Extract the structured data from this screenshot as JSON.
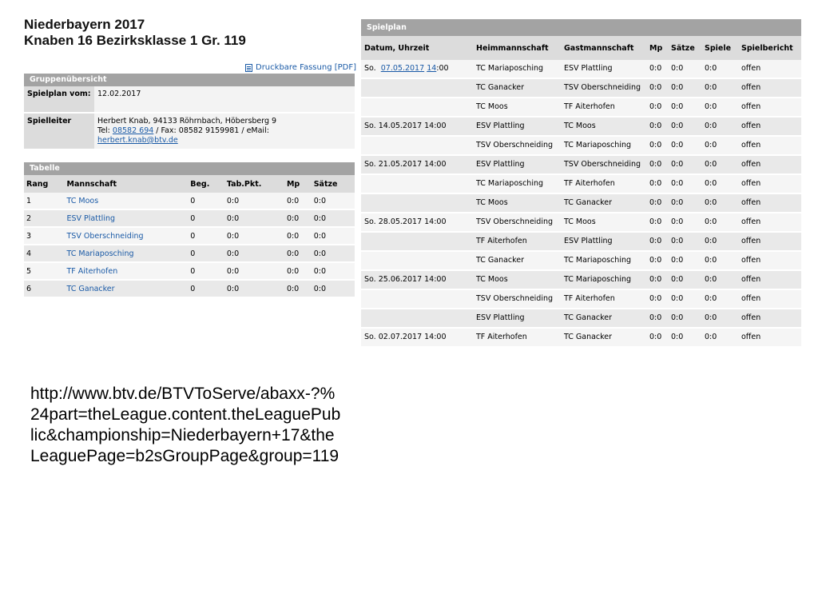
{
  "header": {
    "title_line1": "Niederbayern 2017",
    "title_line2": "Knaben 16 Bezirksklasse 1 Gr. 119",
    "print_link": "Druckbare Fassung [PDF]"
  },
  "gruppe": {
    "heading": "Gruppenübersicht",
    "rows": [
      {
        "key": "Spielplan vom:",
        "value": "12.02.2017"
      },
      {
        "key": "Spielleiter",
        "name": "Herbert Knab, 94133 Röhrnbach, Höbersberg 9",
        "tel_label": "Tel: ",
        "tel": "08582 694",
        "fax": " / Fax: 08582 9159981 / eMail:",
        "email": "herbert.knab@btv.de"
      }
    ]
  },
  "tabelle": {
    "heading": "Tabelle",
    "columns": [
      "Rang",
      "Mannschaft",
      "Beg.",
      "Tab.Pkt.",
      "Mp",
      "Sätze"
    ],
    "rows": [
      [
        "1",
        "TC Moos",
        "0",
        "0:0",
        "0:0",
        "0:0"
      ],
      [
        "2",
        "ESV Plattling",
        "0",
        "0:0",
        "0:0",
        "0:0"
      ],
      [
        "3",
        "TSV Oberschneiding",
        "0",
        "0:0",
        "0:0",
        "0:0"
      ],
      [
        "4",
        "TC Mariaposching",
        "0",
        "0:0",
        "0:0",
        "0:0"
      ],
      [
        "5",
        "TF Aiterhofen",
        "0",
        "0:0",
        "0:0",
        "0:0"
      ],
      [
        "6",
        "TC Ganacker",
        "0",
        "0:0",
        "0:0",
        "0:0"
      ]
    ]
  },
  "spielplan": {
    "heading": "Spielplan",
    "columns": [
      "Datum, Uhrzeit",
      "Heimmannschaft",
      "Gastmannschaft",
      "Mp",
      "Sätze",
      "Spiele",
      "Spielbericht"
    ],
    "rows": [
      {
        "datum": "So.  07.05.2017 14:00",
        "heim": "TC Mariaposching",
        "gast": "ESV Plattling",
        "mp": "0:0",
        "saetze": "0:0",
        "spiele": "0:0",
        "bericht": "offen"
      },
      {
        "datum": "",
        "heim": "TC Ganacker",
        "gast": "TSV Oberschneiding",
        "mp": "0:0",
        "saetze": "0:0",
        "spiele": "0:0",
        "bericht": "offen"
      },
      {
        "datum": "",
        "heim": "TC Moos",
        "gast": "TF Aiterhofen",
        "mp": "0:0",
        "saetze": "0:0",
        "spiele": "0:0",
        "bericht": "offen"
      },
      {
        "datum": "So.  14.05.2017 14:00",
        "heim": "ESV Plattling",
        "gast": "TC Moos",
        "mp": "0:0",
        "saetze": "0:0",
        "spiele": "0:0",
        "bericht": "offen"
      },
      {
        "datum": "",
        "heim": "TSV Oberschneiding",
        "gast": "TC Mariaposching",
        "mp": "0:0",
        "saetze": "0:0",
        "spiele": "0:0",
        "bericht": "offen"
      },
      {
        "datum": "So.  21.05.2017 14:00",
        "heim": "ESV Plattling",
        "gast": "TSV Oberschneiding",
        "mp": "0:0",
        "saetze": "0:0",
        "spiele": "0:0",
        "bericht": "offen"
      },
      {
        "datum": "",
        "heim": "TC Mariaposching",
        "gast": "TF Aiterhofen",
        "mp": "0:0",
        "saetze": "0:0",
        "spiele": "0:0",
        "bericht": "offen"
      },
      {
        "datum": "",
        "heim": "TC Moos",
        "gast": "TC Ganacker",
        "mp": "0:0",
        "saetze": "0:0",
        "spiele": "0:0",
        "bericht": "offen"
      },
      {
        "datum": "So.  28.05.2017 14:00",
        "heim": "TSV Oberschneiding",
        "gast": "TC Moos",
        "mp": "0:0",
        "saetze": "0:0",
        "spiele": "0:0",
        "bericht": "offen"
      },
      {
        "datum": "",
        "heim": "TF Aiterhofen",
        "gast": "ESV Plattling",
        "mp": "0:0",
        "saetze": "0:0",
        "spiele": "0:0",
        "bericht": "offen"
      },
      {
        "datum": "",
        "heim": "TC Ganacker",
        "gast": "TC Mariaposching",
        "mp": "0:0",
        "saetze": "0:0",
        "spiele": "0:0",
        "bericht": "offen"
      },
      {
        "datum": "So.  25.06.2017 14:00",
        "heim": "TC Moos",
        "gast": "TC Mariaposching",
        "mp": "0:0",
        "saetze": "0:0",
        "spiele": "0:0",
        "bericht": "offen"
      },
      {
        "datum": "",
        "heim": "TSV Oberschneiding",
        "gast": "TF Aiterhofen",
        "mp": "0:0",
        "saetze": "0:0",
        "spiele": "0:0",
        "bericht": "offen"
      },
      {
        "datum": "",
        "heim": "ESV Plattling",
        "gast": "TC Ganacker",
        "mp": "0:0",
        "saetze": "0:0",
        "spiele": "0:0",
        "bericht": "offen"
      },
      {
        "datum": "So.  02.07.2017 14:00",
        "heim": "TF Aiterhofen",
        "gast": "TC Ganacker",
        "mp": "0:0",
        "saetze": "0:0",
        "spiele": "0:0",
        "bericht": "offen"
      }
    ]
  },
  "caption": {
    "url": "http://www.btv.de/BTVToServe/abaxx-?%24part=theLeague.content.theLeaguePublic&championship=Niederbayern+17&theLeaguePage=b2sGroupPage&group=119"
  },
  "colors": {
    "panel_header": "#a3a3a3",
    "link": "#1a5aa6",
    "row_light": "#f5f5f5",
    "row_dark": "#e9e9e9"
  }
}
